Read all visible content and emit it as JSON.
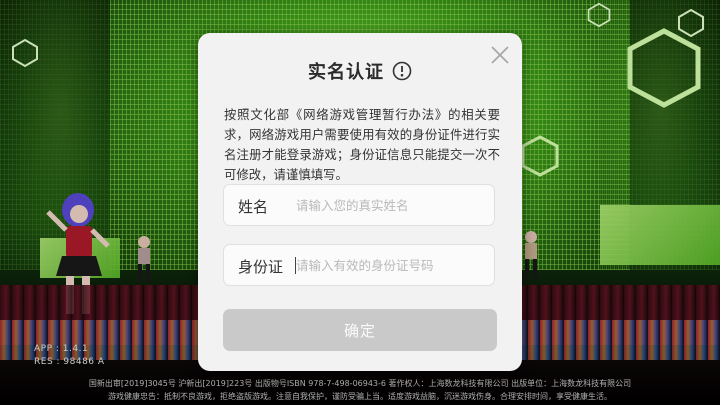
{
  "dialog": {
    "title": "实名认证",
    "title_icon": "info-circle-icon",
    "close_icon": "close-icon",
    "description": "按照文化部《网络游戏管理暂行办法》的相关要求，网络游戏用户需要使用有效的身份证件进行实名注册才能登录游戏；身份证信息只能提交一次不可修改，请谨慎填写。",
    "name_field": {
      "label": "姓名",
      "value": "",
      "placeholder": "请输入您的真实姓名"
    },
    "id_field": {
      "label": "身份证",
      "value": "",
      "placeholder": "请输入有效的身份证号码"
    },
    "confirm_label": "确定",
    "confirm_enabled": false
  },
  "game": {
    "app_version": "APP : 1.4.1",
    "res_version": "RES : 98486 A",
    "footer_line1": "国新出审[2019]3045号    沪新出[2019]223号    出版物号ISBN 978-7-498-06943-6    著作权人：上海数龙科技有限公司    出版单位：上海数龙科技有限公司",
    "footer_line2": "游戏健康忠告：抵制不良游戏，拒绝盗版游戏。注意自我保护，谨防受骗上当。适度游戏益脑，沉迷游戏伤身。合理安排时间，享受健康生活。"
  },
  "colors": {
    "dialog_bg": "#f2f2f2",
    "button_disabled": "#c9c9c9",
    "stage_green": "#7ee23c"
  }
}
